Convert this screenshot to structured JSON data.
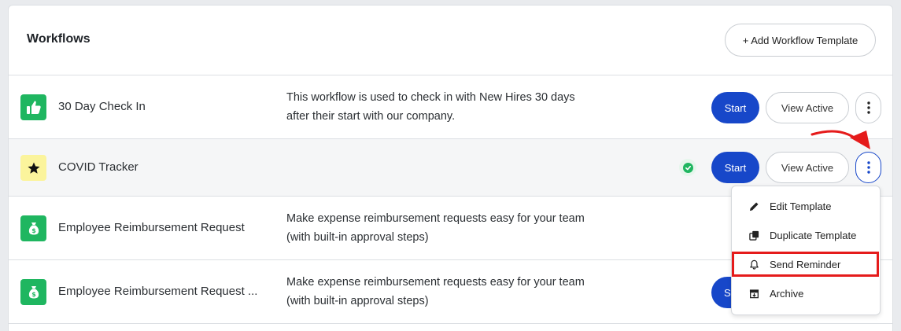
{
  "header": {
    "title": "Workflows",
    "add_button": "+ Add Workflow Template"
  },
  "rows": [
    {
      "name": "30 Day Check In",
      "description_line1": "This workflow is used to check in with New Hires 30 days",
      "description_line2": "after their start with our company.",
      "icon": "thumbs-up-icon",
      "start": "Start",
      "view_active": "View Active"
    },
    {
      "name": "COVID Tracker",
      "description_line1": "",
      "description_line2": "",
      "icon": "star-icon",
      "start": "Start",
      "view_active": "View Active"
    },
    {
      "name": "Employee Reimbursement Request",
      "description_line1": "Make expense reimbursement requests easy for your team",
      "description_line2": "(with built-in approval steps)",
      "icon": "money-bag-icon"
    },
    {
      "name": "Employee Reimbursement Request ...",
      "description_line1": "Make expense reimbursement requests easy for your team",
      "description_line2": "(with built-in approval steps)",
      "icon": "money-bag-icon",
      "start_partial": "S"
    }
  ],
  "menu": {
    "items": [
      {
        "label": "Edit Template",
        "icon": "pencil-icon"
      },
      {
        "label": "Duplicate Template",
        "icon": "duplicate-icon"
      },
      {
        "label": "Send Reminder",
        "icon": "bell-icon"
      },
      {
        "label": "Archive",
        "icon": "archive-icon"
      }
    ]
  },
  "colors": {
    "primary": "#1747c9",
    "icon_green": "#1fb660",
    "icon_yellow": "#fbf49c",
    "highlight_red": "#e51b1b"
  }
}
